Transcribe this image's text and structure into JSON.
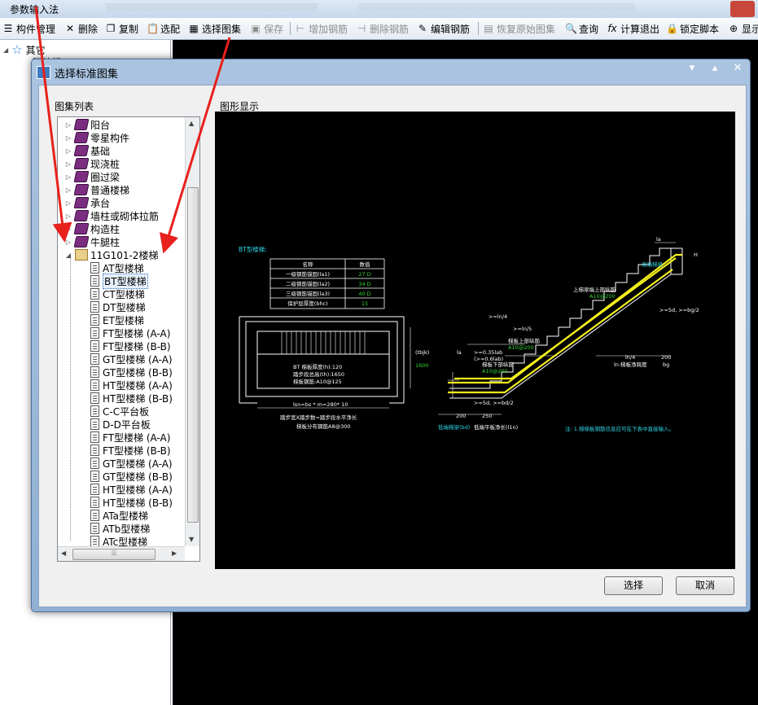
{
  "app": {
    "title": "参数输入法"
  },
  "toolbar": {
    "items": [
      {
        "label": "构件管理",
        "icon": "list-icon",
        "enabled": true
      },
      {
        "label": "删除",
        "icon": "close-icon",
        "enabled": true
      },
      {
        "label": "复制",
        "icon": "copy-icon",
        "enabled": true
      },
      {
        "label": "选配",
        "icon": "paste-icon",
        "enabled": true
      },
      {
        "label": "选择图集",
        "icon": "atlas-icon",
        "enabled": true
      },
      {
        "label": "保存",
        "icon": "save-icon",
        "enabled": false
      },
      {
        "label": "增加钢筋",
        "icon": "add-rebar-icon",
        "enabled": false
      },
      {
        "label": "删除钢筋",
        "icon": "delete-rebar-icon",
        "enabled": false
      },
      {
        "label": "编辑钢筋",
        "icon": "edit-rebar-icon",
        "enabled": true
      },
      {
        "label": "恢复原始图集",
        "icon": "restore-icon",
        "enabled": false
      },
      {
        "label": "查询",
        "icon": "search-icon",
        "enabled": true
      },
      {
        "label": "计算退出",
        "icon": "function-icon",
        "enabled": true
      },
      {
        "label": "锁定脚本",
        "icon": "lock-icon",
        "enabled": true
      },
      {
        "label": "显示",
        "icon": "zoom-icon",
        "enabled": true
      }
    ]
  },
  "left_tree": {
    "root": "其它",
    "child": "砌块墙"
  },
  "dialog": {
    "title": "选择标准图集",
    "atlas_list_label": "图集列表",
    "preview_label": "图形显示",
    "select_button": "选择",
    "cancel_button": "取消",
    "tree": {
      "categories": [
        "阳台",
        "零星构件",
        "基础",
        "现浇桩",
        "圈过梁",
        "普通楼梯",
        "承台",
        "墙柱或砌体拉筋",
        "构造柱",
        "牛腿柱"
      ],
      "open_folder": "11G101-2楼梯",
      "items": [
        "AT型楼梯",
        "BT型楼梯",
        "CT型楼梯",
        "DT型楼梯",
        "ET型楼梯",
        "FT型楼梯 (A-A)",
        "FT型楼梯 (B-B)",
        "GT型楼梯 (A-A)",
        "GT型楼梯 (B-B)",
        "HT型楼梯 (A-A)",
        "HT型楼梯 (B-B)",
        "C-C平台板",
        "D-D平台板",
        "FT型楼梯 (A-A)",
        "FT型楼梯 (B-B)",
        "GT型楼梯 (A-A)",
        "GT型楼梯 (B-B)",
        "HT型楼梯 (A-A)",
        "HT型楼梯 (B-B)",
        "ATa型楼梯",
        "ATb型楼梯",
        "ATc型楼梯"
      ],
      "selected": "BT型楼梯"
    },
    "drawing": {
      "heading": "BT型楼梯:",
      "table": {
        "headers": [
          "名称",
          "数值"
        ],
        "rows": [
          [
            "一级钢筋锚固(la1)",
            "27 D"
          ],
          [
            "二级钢筋锚固(la2)",
            "34 D"
          ],
          [
            "三级钢筋锚固(la3)",
            "40 D"
          ],
          [
            "保护层厚度(bhc)",
            "15"
          ]
        ]
      },
      "plan_notes": [
        "BT 梯板厚度(h):120",
        "踏步段总高(th):1650",
        "梯板钢筋:A10@125"
      ],
      "plan_dim_right": "(tbjk)",
      "plan_dim_right_val": "1600",
      "plan_dim_bottom": "lsn=bs * m=280* 10",
      "plan_caption1": "踏步宽X踏步数=踏步段水平净长",
      "plan_caption2": "梯板分布钢筋A8@300",
      "sec_labels": {
        "top_rebar": "上梯梁端上部纵筋",
        "top_rebar_val": "A10@200",
        "high_beam": "高端梯梁",
        "low_beam": "低端梯梁(bd)",
        "low_flat": "低端平板净长(l1n)",
        "ln4": ">=ln/4",
        "ln5": ">=ln/5",
        "mid_rebar": "梯板上部纵筋",
        "mid_rebar_val": "A10@200",
        "low_rebar": "梯板下部纵筋",
        "low_rebar_val": "A10@200",
        "len_a": ">=0.35lab",
        "len_b": "(>=0.6lab)",
        "la": "la",
        "five_d": ">=5d, >=bd/2",
        "five_d_r": ">=5d, >=bg/2",
        "ln4b": "ln/4",
        "ln_net": "ln:梯板净跨度",
        "dim200": "200",
        "bg": "bg",
        "dim200b": "200",
        "dim250": "250",
        "h_label": "H"
      },
      "note": "注: 1.梯梯板钢筋信息应可在下表中直接输入。"
    }
  },
  "colors": {
    "canvas": "#000000",
    "cad_white": "#ffffff",
    "cad_cyan": "#2fd6e6",
    "cad_green": "#35d435",
    "cad_yellow": "#f2ef1e",
    "arrow_red": "#e8211c",
    "dialog_frame": "#9db9da"
  }
}
